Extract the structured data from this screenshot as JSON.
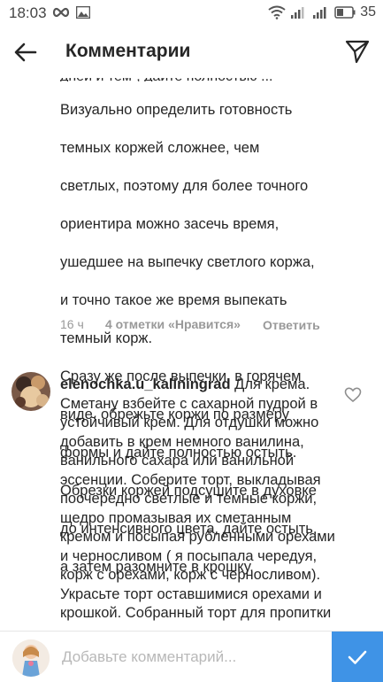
{
  "status_bar": {
    "time": "18:03",
    "battery": "35",
    "icons": [
      "infinity-icon",
      "image-icon",
      "wifi-icon",
      "signal-icon",
      "signal-icon",
      "battery-icon"
    ]
  },
  "header": {
    "title": "Комментарии",
    "back_icon": "arrow-left-icon",
    "send_icon": "paper-plane-icon"
  },
  "comments": [
    {
      "text_lines": [
        "Визуально определить готовность",
        "темных коржей сложнее, чем",
        "светлых, поэтому для более точного",
        "ориентира можно засечь время,",
        "ушедшее на выпечку светлого коржа,",
        "и точно такое же время выпекать",
        "темный корж.",
        "Сразу же после выпечки, в горячем",
        "виде, обрежьте коржи по размеру",
        "формы и дайте полностью остыть.",
        "Обрезки коржей подсушите в духовке",
        "до интенсивного цвета, дайте остыть,",
        "а затем разомните в крошку."
      ],
      "time": "16 ч",
      "likes": "4 отметки «Нравится»",
      "reply": "Ответить"
    },
    {
      "username": "elenochka.u_kaliningrad",
      "text": "Для крема. Сметану взбейте с сахарной пудрой в устойчивый крем. Для отдушки можно добавить в крем немного ванилина, ванильного сахара или ванильной эссенции. Соберите торт, выкладывая поочередно светлые и темные коржи, щедро промазывая их сметанным кремом и посыпая рубленными орехами и черносливом ( я посыпала чередуя, корж с орехами, корж с черносливом). Украсьте торт оставшимися орехами и крошкой. Собранный торт для пропитки"
    }
  ],
  "input_bar": {
    "placeholder": "Добавьте комментарий...",
    "post_icon": "checkmark-icon"
  },
  "colors": {
    "accent": "#3f93e6",
    "meta_gray": "#999999",
    "text": "#262626"
  }
}
